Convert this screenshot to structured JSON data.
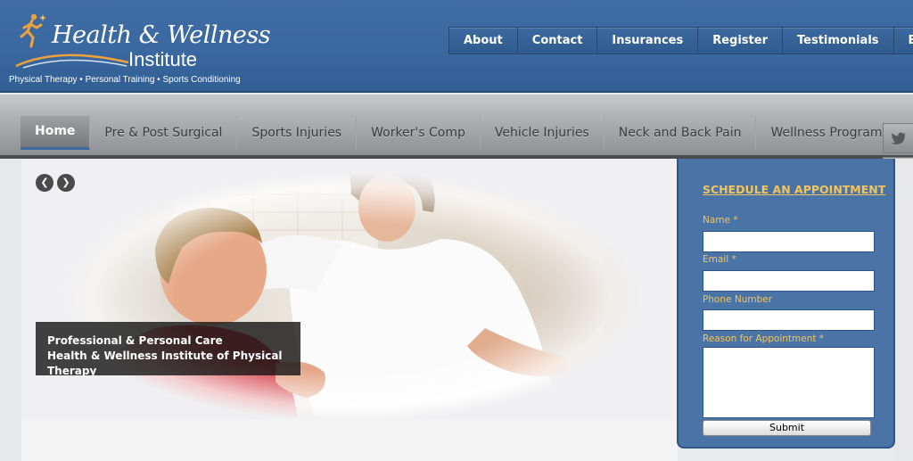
{
  "logo": {
    "line1": "Health & Wellness",
    "line2": "Institute",
    "tagline": "Physical Therapy • Personal Training • Sports Conditioning"
  },
  "topnav": {
    "items": [
      "About",
      "Contact",
      "Insurances",
      "Register",
      "Testimonials",
      "Blog"
    ]
  },
  "mainnav": {
    "items": [
      "Home",
      "Pre & Post Surgical",
      "Sports Injuries",
      "Worker's Comp",
      "Vehicle Injuries",
      "Neck and Back Pain",
      "Wellness Programs"
    ],
    "active": "Home"
  },
  "social": {
    "twitter_icon": "twitter-icon",
    "facebook_icon": "facebook-icon"
  },
  "slider": {
    "prev_icon": "chevron-left-icon",
    "next_icon": "chevron-right-icon",
    "caption_line1": "Professional & Personal Care",
    "caption_line2": "Health & Wellness Institute of Physical Therapy"
  },
  "form": {
    "title": "SCHEDULE AN APPOINTMENT",
    "name_label": "Name *",
    "email_label": "Email *",
    "phone_label": "Phone Number",
    "reason_label": "Reason for Appointment *",
    "submit_label": "Submit"
  },
  "colors": {
    "header_blue": "#3a68a0",
    "form_panel_blue": "#4a74a6",
    "form_label_gold": "#f3c45a",
    "nav_gray": "#b2b3b6"
  }
}
